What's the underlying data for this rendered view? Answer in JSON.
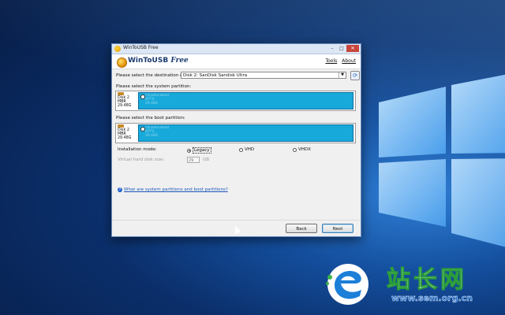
{
  "window": {
    "title": "WinToUSB Free"
  },
  "app": {
    "brand_name": "WinToUSB",
    "brand_edition": "Free",
    "menu": {
      "tools": "Tools",
      "about": "About"
    }
  },
  "destination": {
    "label": "Please select the destination disk:",
    "selected": "Disk 2: SanDisk Sandisk Ultra"
  },
  "system_partition": {
    "label": "Please select the system partition:",
    "disk": {
      "name": "Disk 2",
      "style": "MBR",
      "size": "29.48G"
    },
    "partition_lines": [
      "(Unallocated)",
      "NTFS",
      "29.48G"
    ]
  },
  "boot_partition": {
    "label": "Please select the boot partition:",
    "disk": {
      "name": "Disk 2",
      "style": "MBR",
      "size": "29.48G"
    },
    "partition_lines": [
      "(Unallocated)",
      "NTFS",
      "29.48G"
    ]
  },
  "installation_mode": {
    "label": "Installation mode:",
    "options": [
      "Legacy",
      "VHD",
      "VHDX"
    ],
    "selected": "Legacy"
  },
  "vhd": {
    "label": "Virtual hard disk size:",
    "value": "29",
    "unit": "GB"
  },
  "help_link": "What are system partitions and boot partitions?",
  "buttons": {
    "back": "Back",
    "next": "Next"
  },
  "watermark": {
    "chinese": "站长网",
    "url": "www.sem.org.cn"
  },
  "colors": {
    "partition_fill": "#17a9d9",
    "link": "#1a56b8",
    "desktop": "#0b2f6b"
  }
}
